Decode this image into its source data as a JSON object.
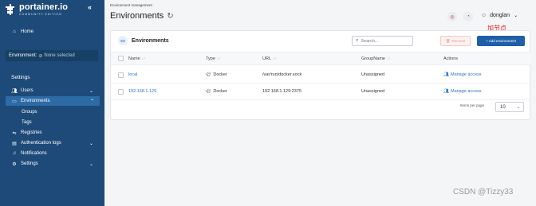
{
  "app": {
    "logo_text": "portainer.io",
    "logo_sub": "COMMUNITY EDITION",
    "collapse_icon": "double-chevron-left-icon"
  },
  "sidebar": {
    "home": "Home",
    "env_prefix": "Environment:",
    "env_value": "None selected",
    "section": "Settings",
    "items": [
      {
        "label": "Users",
        "icon": "users-icon"
      },
      {
        "label": "Environments",
        "icon": "environments-icon"
      },
      {
        "label": "Groups"
      },
      {
        "label": "Tags"
      },
      {
        "label": "Registries",
        "icon": "registries-icon"
      },
      {
        "label": "Authentication logs",
        "icon": "auth-logs-icon"
      },
      {
        "label": "Notifications",
        "icon": "bell-icon"
      },
      {
        "label": "Settings",
        "icon": "gear-icon"
      }
    ]
  },
  "header": {
    "breadcrumb": "Environment management",
    "title": "Environments",
    "username": "donglan"
  },
  "card": {
    "title": "Environments",
    "search_placeholder": "Search...",
    "remove_label": "Remove",
    "add_label": "+ Add environment",
    "annotation": "加节点",
    "columns": [
      "Name",
      "Type",
      "URL",
      "GroupName",
      "Actions"
    ],
    "rows": [
      {
        "name": "local",
        "type": "Docker",
        "url": "/var/run/docker.sock",
        "group": "Unassigned",
        "action": "Manage access"
      },
      {
        "name": "192.168.1.129",
        "type": "Docker",
        "url": "192.168.1.129:2375",
        "group": "Unassigned",
        "action": "Manage access"
      }
    ],
    "items_per_page_label": "Items per page",
    "items_per_page_value": "10"
  },
  "watermark": "CSDN @Tizzy33",
  "colors": {
    "sidebar": "#1d4a78",
    "sidebar_active": "#2d6ba7",
    "primary": "#1f5ea8",
    "link": "#2b73c8",
    "annotation": "#e0201a"
  }
}
